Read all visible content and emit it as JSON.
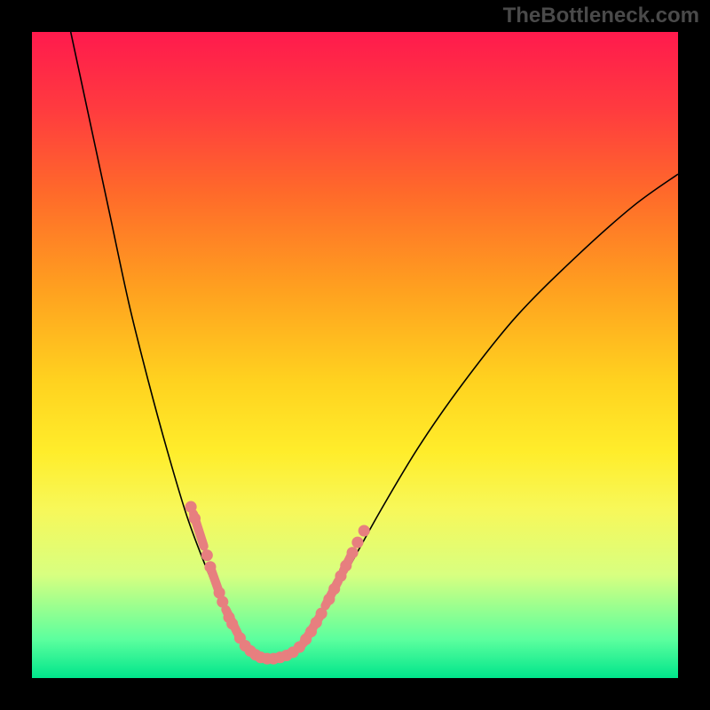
{
  "watermark": "TheBottleneck.com",
  "colors": {
    "curve": "#000000",
    "markers": "#e77f7f",
    "gradient_top": "#ff1a4d",
    "gradient_bottom": "#00e58b"
  },
  "chart_data": {
    "type": "line",
    "title": "",
    "xlabel": "",
    "ylabel": "",
    "xlim": [
      0,
      100
    ],
    "ylim": [
      0,
      100
    ],
    "grid": false,
    "legend": false,
    "note": "Axis values are in percent of plot width/height; y is percent from top. Curve is a V-shape with minimum near x≈36, y≈97. Markers are sample points clustered on both arms of the V near the bottom.",
    "series": [
      {
        "name": "bottleneck-curve",
        "points": [
          {
            "x": 6.0,
            "y": 0.0
          },
          {
            "x": 9.0,
            "y": 14.0
          },
          {
            "x": 12.0,
            "y": 28.0
          },
          {
            "x": 15.0,
            "y": 42.0
          },
          {
            "x": 18.0,
            "y": 54.0
          },
          {
            "x": 21.0,
            "y": 65.0
          },
          {
            "x": 24.0,
            "y": 75.0
          },
          {
            "x": 27.0,
            "y": 83.0
          },
          {
            "x": 30.0,
            "y": 90.0
          },
          {
            "x": 33.0,
            "y": 95.0
          },
          {
            "x": 36.0,
            "y": 97.0
          },
          {
            "x": 39.0,
            "y": 96.5
          },
          {
            "x": 42.0,
            "y": 94.0
          },
          {
            "x": 45.0,
            "y": 90.0
          },
          {
            "x": 49.0,
            "y": 83.0
          },
          {
            "x": 54.0,
            "y": 74.0
          },
          {
            "x": 60.0,
            "y": 64.0
          },
          {
            "x": 67.0,
            "y": 54.0
          },
          {
            "x": 75.0,
            "y": 44.0
          },
          {
            "x": 84.0,
            "y": 35.0
          },
          {
            "x": 93.0,
            "y": 27.0
          },
          {
            "x": 100.0,
            "y": 22.0
          }
        ]
      }
    ],
    "markers": {
      "dot_radius_pct": 0.9,
      "pill_width_pct": 1.4,
      "left_arm_dots": [
        {
          "x": 24.6,
          "y": 73.5
        },
        {
          "x": 25.2,
          "y": 75.3
        },
        {
          "x": 27.1,
          "y": 81.0
        },
        {
          "x": 27.6,
          "y": 82.8
        },
        {
          "x": 29.0,
          "y": 86.8
        },
        {
          "x": 29.5,
          "y": 88.2
        },
        {
          "x": 30.5,
          "y": 90.6
        },
        {
          "x": 31.0,
          "y": 91.6
        },
        {
          "x": 32.2,
          "y": 93.8
        },
        {
          "x": 33.0,
          "y": 95.0
        },
        {
          "x": 33.8,
          "y": 95.8
        },
        {
          "x": 34.6,
          "y": 96.4
        }
      ],
      "left_arm_pills": [
        {
          "x1": 25.0,
          "y1": 74.6,
          "x2": 26.6,
          "y2": 79.6
        },
        {
          "x1": 27.8,
          "y1": 83.4,
          "x2": 28.8,
          "y2": 86.2
        },
        {
          "x1": 30.0,
          "y1": 89.4,
          "x2": 31.8,
          "y2": 93.0
        }
      ],
      "bottom_dots": [
        {
          "x": 35.4,
          "y": 96.8
        },
        {
          "x": 36.4,
          "y": 97.0
        },
        {
          "x": 37.4,
          "y": 97.0
        },
        {
          "x": 38.4,
          "y": 96.8
        },
        {
          "x": 39.4,
          "y": 96.5
        },
        {
          "x": 40.4,
          "y": 96.0
        },
        {
          "x": 41.4,
          "y": 95.2
        }
      ],
      "right_arm_dots": [
        {
          "x": 42.4,
          "y": 94.0
        },
        {
          "x": 43.2,
          "y": 92.8
        },
        {
          "x": 44.0,
          "y": 91.4
        },
        {
          "x": 44.8,
          "y": 90.0
        },
        {
          "x": 46.0,
          "y": 87.8
        },
        {
          "x": 46.8,
          "y": 86.2
        },
        {
          "x": 47.8,
          "y": 84.2
        },
        {
          "x": 48.6,
          "y": 82.6
        },
        {
          "x": 49.6,
          "y": 80.6
        },
        {
          "x": 50.4,
          "y": 79.0
        },
        {
          "x": 51.4,
          "y": 77.2
        }
      ],
      "right_arm_pills": [
        {
          "x1": 42.0,
          "y1": 94.6,
          "x2": 44.6,
          "y2": 90.4
        },
        {
          "x1": 45.4,
          "y1": 88.8,
          "x2": 47.4,
          "y2": 85.0
        },
        {
          "x1": 48.2,
          "y1": 83.4,
          "x2": 49.4,
          "y2": 81.0
        }
      ]
    }
  }
}
